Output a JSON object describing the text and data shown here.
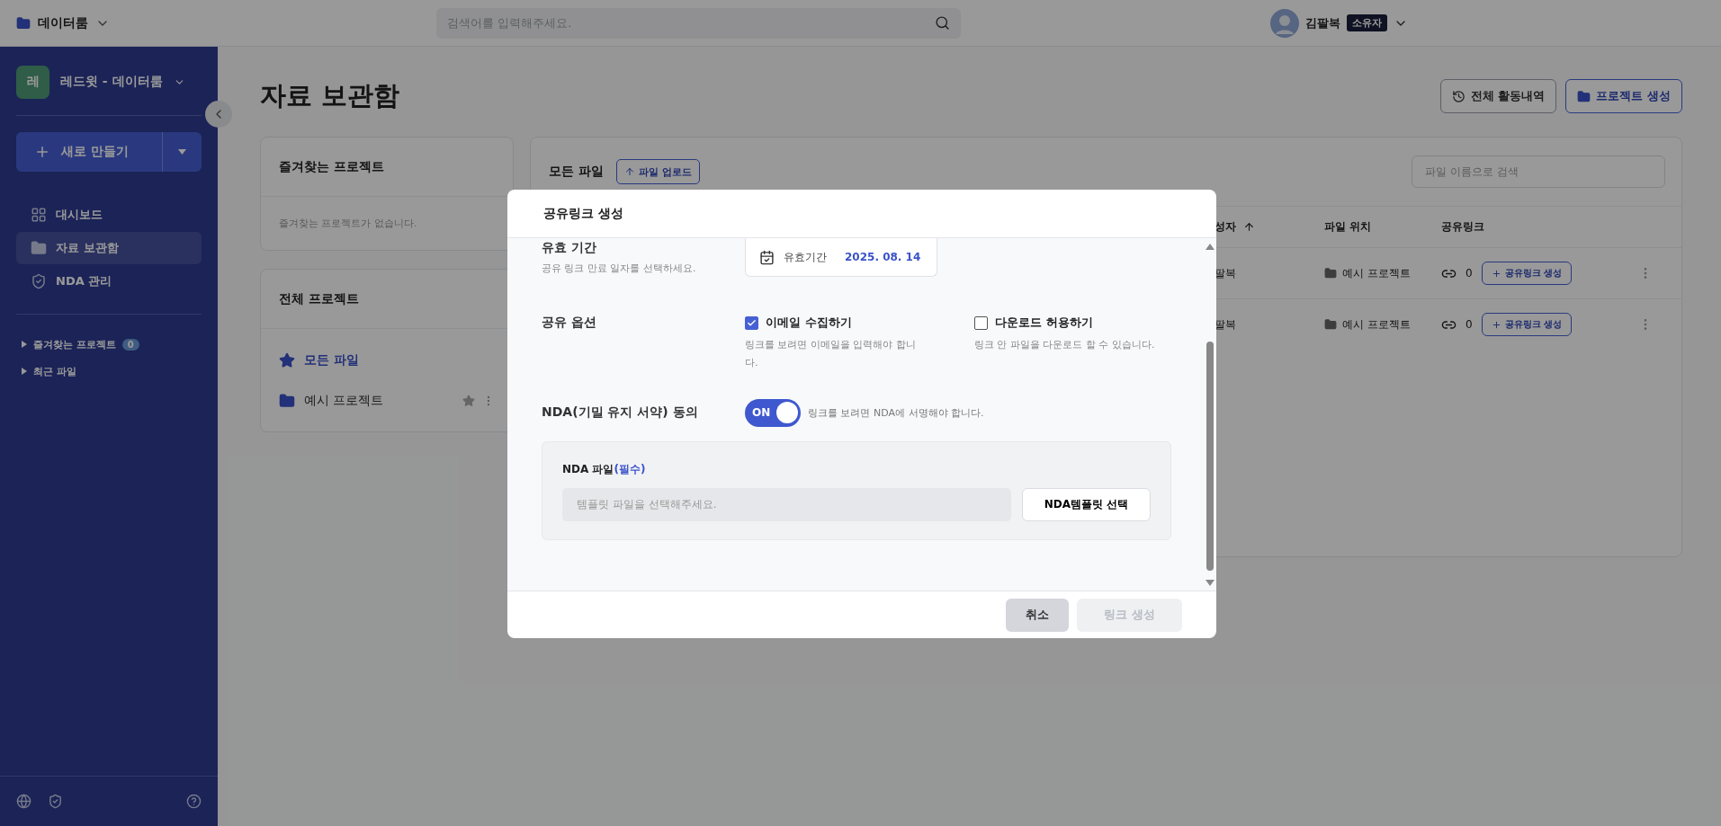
{
  "topbar": {
    "workspace": "데이터룸",
    "search_placeholder": "검색어를 입력해주세요.",
    "user_name": "김팔복",
    "role_badge": "소유자"
  },
  "sidebar": {
    "org_avatar": "레",
    "org_name": "레드윗 - 데이터룸",
    "new_button": "새로 만들기",
    "nav": [
      {
        "label": "대시보드",
        "kind": "dashboard",
        "selected": false
      },
      {
        "label": "자료 보관함",
        "kind": "folder",
        "selected": true
      },
      {
        "label": "NDA 관리",
        "kind": "shield",
        "selected": false
      }
    ],
    "sections": [
      {
        "label": "즐겨찾는 프로젝트",
        "count": "0"
      },
      {
        "label": "최근 파일"
      }
    ]
  },
  "page": {
    "title": "자료 보관함",
    "actions": [
      {
        "label": "전체 활동내역",
        "kind": "outline"
      },
      {
        "label": "프로젝트 생성",
        "kind": "primary"
      }
    ]
  },
  "favorites": {
    "title": "즐겨찾는 프로젝트",
    "empty": "즐겨찾는 프로젝트가 없습니다."
  },
  "projects": {
    "title": "전체 프로젝트",
    "items": [
      {
        "label": "모든 파일",
        "selected": true,
        "kind": "all"
      },
      {
        "label": "예시 프로젝트",
        "selected": false,
        "kind": "project"
      }
    ]
  },
  "files": {
    "title": "모든 파일",
    "upload": "파일 업로드",
    "search_placeholder": "파일 이름으로 검색",
    "columns": [
      "성자",
      "파일 위치",
      "공유링크"
    ],
    "rows": [
      {
        "creator": "팔복",
        "location": "예시 프로젝트",
        "link_count": "0",
        "link_button": "공유링크 생성"
      },
      {
        "creator": "팔복",
        "location": "예시 프로젝트",
        "link_count": "0",
        "link_button": "공유링크 생성"
      }
    ]
  },
  "modal": {
    "title": "공유링크 생성",
    "expiry": {
      "label": "유효 기간",
      "hint": "공유 링크 만료 일자를 선택하세요.",
      "field_label": "유효기간",
      "date": "2025. 08. 14"
    },
    "options": {
      "label": "공유 옵션",
      "items": [
        {
          "label": "이메일 수집하기",
          "desc": "링크를 보려면 이메일을 입력해야 합니다.",
          "checked": true
        },
        {
          "label": "다운로드 허용하기",
          "desc": "링크 안 파일을 다운로드 할 수 있습니다.",
          "checked": false
        }
      ]
    },
    "nda": {
      "label": "NDA(기밀 유지 서약) 동의",
      "on": true,
      "switch_text": "ON",
      "desc": "링크를 보려면 NDA에 서명해야 합니다.",
      "file_label": "NDA 파일",
      "required": "(필수)",
      "placeholder": "템플릿 파일을 선택해주세요.",
      "template_button": "NDA템플릿 선택"
    },
    "buttons": [
      {
        "label": "취소",
        "kind": "cancel",
        "disabled": false
      },
      {
        "label": "링크 생성",
        "kind": "submit",
        "disabled": true
      }
    ]
  }
}
